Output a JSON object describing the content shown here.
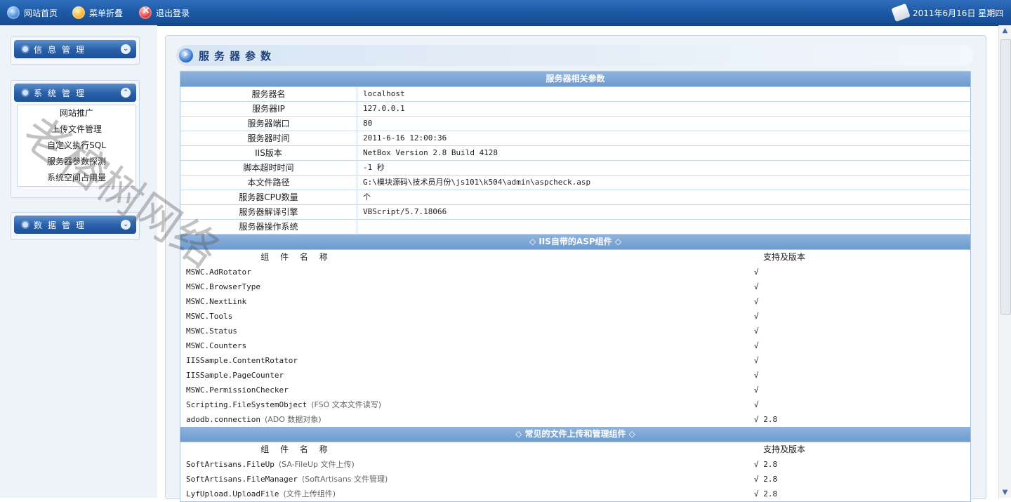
{
  "topbar": {
    "home_label": "网站首页",
    "fold_label": "菜单折叠",
    "logout_label": "退出登录",
    "date_label": "2011年6月16日 星期四"
  },
  "sidebar": {
    "groups": [
      {
        "title": "信息管理",
        "expanded": false
      },
      {
        "title": "系统管理",
        "expanded": true,
        "items": [
          "网站推广",
          "上传文件管理",
          "自定义执行SQL",
          "服务器参数探测",
          "系统空间占用量"
        ]
      },
      {
        "title": "数据管理",
        "expanded": false
      }
    ]
  },
  "page": {
    "title": "服务器参数"
  },
  "server_params": {
    "header": "服务器相关参数",
    "rows": [
      {
        "k": "服务器名",
        "v": "localhost"
      },
      {
        "k": "服务器IP",
        "v": "127.0.0.1"
      },
      {
        "k": "服务器端口",
        "v": "80"
      },
      {
        "k": "服务器时间",
        "v": "2011-6-16 12:00:36"
      },
      {
        "k": "IIS版本",
        "v": "NetBox Version 2.8 Build 4128"
      },
      {
        "k": "脚本超时时间",
        "v": "-1 秒"
      },
      {
        "k": "本文件路径",
        "v": "G:\\模块源码\\技术员月份\\js101\\k504\\admin\\aspcheck.asp"
      },
      {
        "k": "服务器CPU数量",
        "v": " 个"
      },
      {
        "k": "服务器解译引擎",
        "v": "VBScript/5.7.18066"
      },
      {
        "k": "服务器操作系统",
        "v": ""
      }
    ]
  },
  "iis_components": {
    "header": "◇ IIS自带的ASP组件 ◇",
    "col_name": "组 件 名 称",
    "col_support": "支持及版本",
    "rows": [
      {
        "name": "MSWC.AdRotator",
        "desc": "",
        "support": "√"
      },
      {
        "name": "MSWC.BrowserType",
        "desc": "",
        "support": "√"
      },
      {
        "name": "MSWC.NextLink",
        "desc": "",
        "support": "√"
      },
      {
        "name": "MSWC.Tools",
        "desc": "",
        "support": "√"
      },
      {
        "name": "MSWC.Status",
        "desc": "",
        "support": "√"
      },
      {
        "name": "MSWC.Counters",
        "desc": "",
        "support": "√"
      },
      {
        "name": "IISSample.ContentRotator",
        "desc": "",
        "support": "√"
      },
      {
        "name": "IISSample.PageCounter",
        "desc": "",
        "support": "√"
      },
      {
        "name": "MSWC.PermissionChecker",
        "desc": "",
        "support": "√"
      },
      {
        "name": "Scripting.FileSystemObject",
        "desc": "(FSO 文本文件读写)",
        "support": "√"
      },
      {
        "name": "adodb.connection",
        "desc": "(ADO 数据对象)",
        "support": "√ 2.8"
      }
    ]
  },
  "upload_components": {
    "header": "◇ 常见的文件上传和管理组件 ◇",
    "col_name": "组 件 名 称",
    "col_support": "支持及版本",
    "rows": [
      {
        "name": "SoftArtisans.FileUp",
        "desc": "(SA-FileUp 文件上传)",
        "support": "√ 2.8"
      },
      {
        "name": "SoftArtisans.FileManager",
        "desc": "(SoftArtisans 文件管理)",
        "support": "√ 2.8"
      },
      {
        "name": "LyfUpload.UploadFile",
        "desc": "(文件上传组件)",
        "support": "√ 2.8"
      }
    ]
  },
  "watermark": "老榕树网络"
}
